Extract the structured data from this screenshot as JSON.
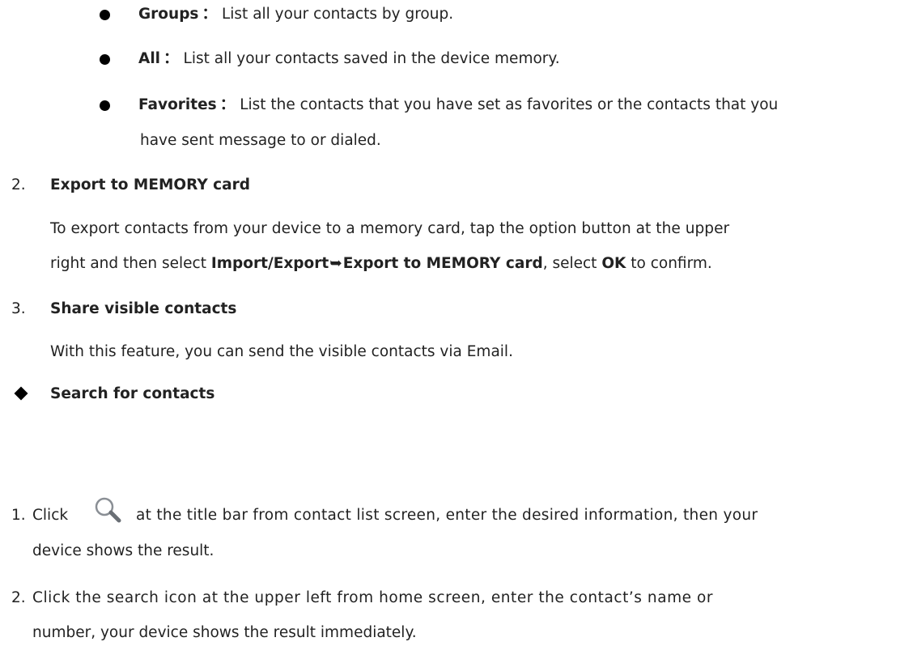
{
  "bullets": [
    {
      "term": "Groups",
      "colon": "：",
      "text": "List all your contacts by group."
    },
    {
      "term": "All",
      "colon": "：",
      "text": "List all your contacts saved in the device memory."
    },
    {
      "term": "Favorites",
      "colon": "：",
      "text_line1": "List the contacts that you have set as favorites or the contacts that you",
      "text_line2": "have sent message to or dialed."
    }
  ],
  "items": [
    {
      "number": "2.",
      "heading": "Export to MEMORY card",
      "line1": "To export contacts from your device to a memory card, tap the option button at the upper",
      "line2_pre": "right and then select ",
      "line2_bold1": "Import/Export",
      "line2_arrow": "➥",
      "line2_bold2": "Export to MEMORY card",
      "line2_mid": ", select ",
      "line2_bold3": "OK",
      "line2_post": " to confirm."
    },
    {
      "number": "3.",
      "heading": "Share visible contacts",
      "line1": "With this feature, you can send the visible contacts via Email."
    }
  ],
  "section": {
    "title": "Search for contacts",
    "steps": [
      {
        "number": "1.",
        "pre": "Click",
        "icon": "search-icon",
        "line1": "at the title bar from contact list screen, enter the desired information, then your",
        "line2": "device shows the result."
      },
      {
        "number": "2.",
        "line1": "Click the search icon at the upper left from home screen, enter the contact’s name or",
        "line2": "number, your device shows the result immediately."
      }
    ]
  }
}
